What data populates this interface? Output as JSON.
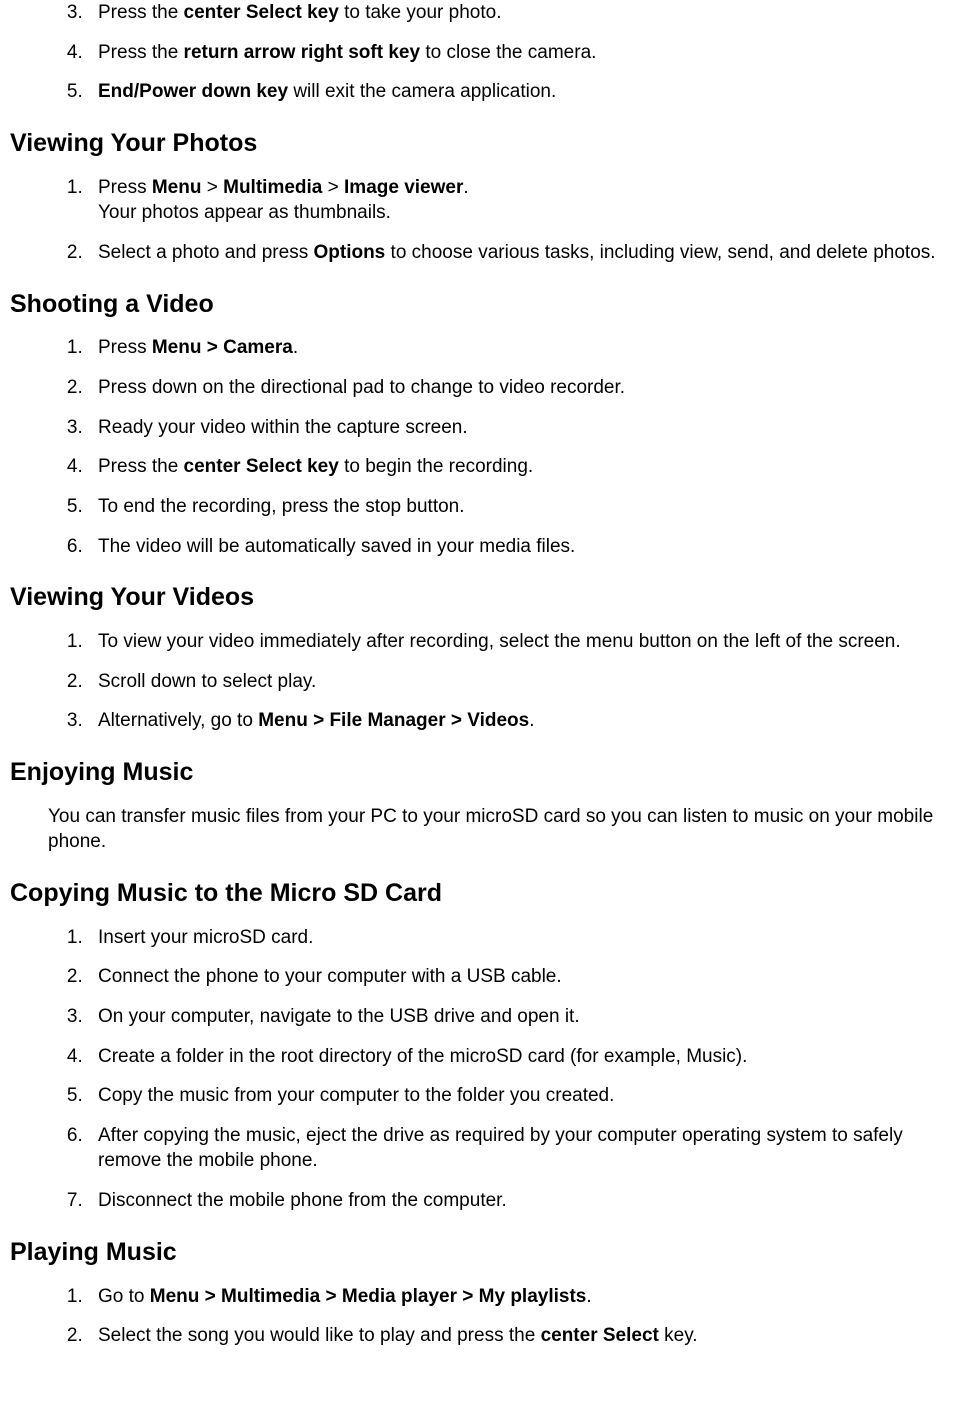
{
  "section0": {
    "items": [
      {
        "num": "3.",
        "html": "Press the <strong>center Select key</strong> to take your photo."
      },
      {
        "num": "4.",
        "html": "Press the <strong>return arrow right soft key</strong> to close the camera."
      },
      {
        "num": "5.",
        "html": "<strong>End/Power down key</strong> will exit the camera application."
      }
    ]
  },
  "section1": {
    "heading": "Viewing Your Photos",
    "items": [
      {
        "num": "1.",
        "html": "Press <strong>Menu</strong> > <strong>Multimedia</strong> > <strong>Image viewer</strong>.<br>Your photos appear as thumbnails."
      },
      {
        "num": "2.",
        "html": "Select a photo and press <strong>Options</strong> to choose various tasks, including view, send, and delete photos."
      }
    ]
  },
  "section2": {
    "heading": "Shooting a Video",
    "items": [
      {
        "num": "1.",
        "html": "Press <strong>Menu > Camera</strong>."
      },
      {
        "num": "2.",
        "html": "Press down on the directional pad to change to video recorder."
      },
      {
        "num": "3.",
        "html": "Ready your video within the capture screen."
      },
      {
        "num": "4.",
        "html": "Press the <strong>center Select key</strong> to begin the recording."
      },
      {
        "num": "5.",
        "html": "To end the recording, press the stop button."
      },
      {
        "num": "6.",
        "html": "The video will be automatically saved in your media files."
      }
    ]
  },
  "section3": {
    "heading": "Viewing Your  Videos",
    "items": [
      {
        "num": "1.",
        "html": "To view your video immediately after recording, select the menu button on the left of the screen."
      },
      {
        "num": "2.",
        "html": "Scroll down to select play."
      },
      {
        "num": "3.",
        "html": "Alternatively, go to <strong>Menu > File Manager > Videos</strong>."
      }
    ]
  },
  "section4": {
    "heading": "Enjoying Music",
    "para": "You can transfer music files from your PC to your microSD card so you can listen to music on your mobile phone."
  },
  "section5": {
    "heading": "Copying Music to  the  Micro SD Card",
    "items": [
      {
        "num": "1.",
        "html": "Insert your microSD card."
      },
      {
        "num": "2.",
        "html": "Connect the phone to your computer with a USB cable."
      },
      {
        "num": "3.",
        "html": "On your computer, navigate to the USB drive and open it."
      },
      {
        "num": "4.",
        "html": "Create a folder in the root directory of the microSD card (for example, Music)."
      },
      {
        "num": "5.",
        "html": "Copy the music from your computer to the folder you created."
      },
      {
        "num": "6.",
        "html": "After copying the music, eject the drive as required by your computer operating system to safely remove the mobile phone."
      },
      {
        "num": "7.",
        "html": "Disconnect the mobile phone from the computer."
      }
    ]
  },
  "section6": {
    "heading": "Playing Music",
    "items": [
      {
        "num": "1.",
        "html": "Go to <strong>Menu > Multimedia > Media player > My playlists</strong>."
      },
      {
        "num": "2.",
        "html": "Select the song you would like to play and press the <strong>center Select</strong> key."
      }
    ]
  }
}
